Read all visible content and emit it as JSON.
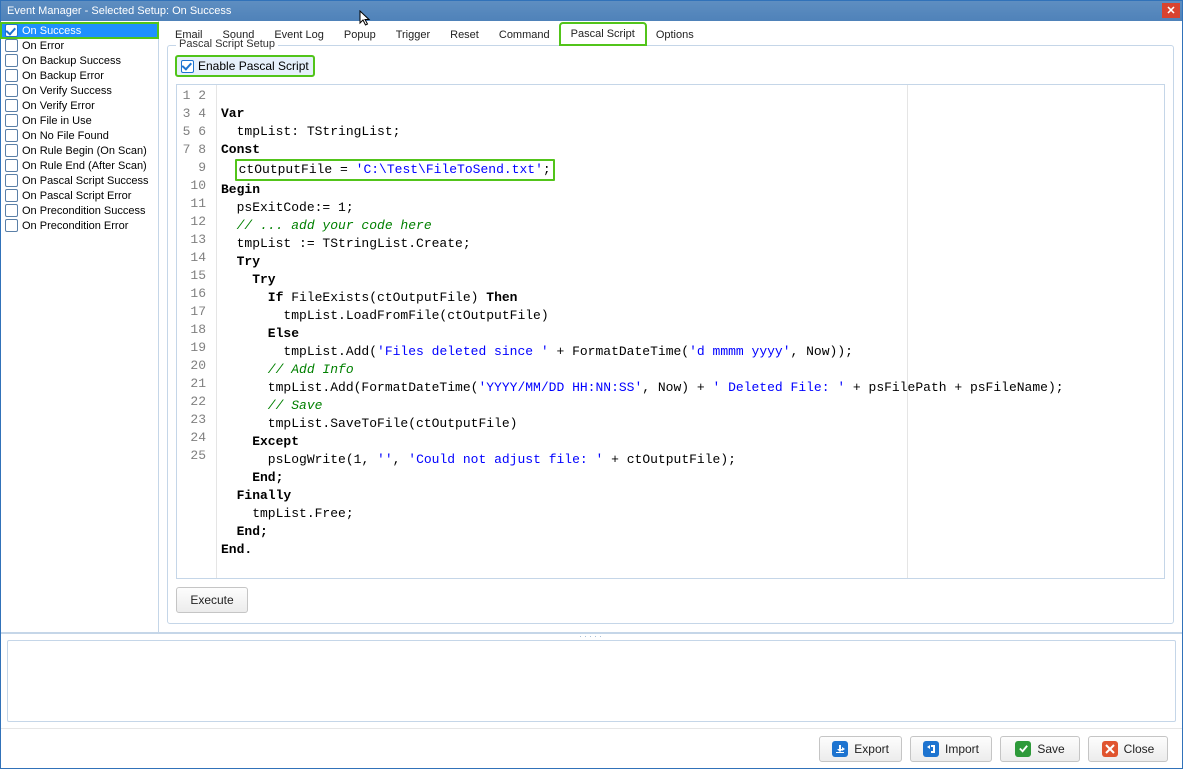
{
  "title": "Event Manager - Selected Setup: On Success",
  "sidebar": {
    "items": [
      {
        "label": "On Success",
        "checked": true,
        "selected": true
      },
      {
        "label": "On Error",
        "checked": false
      },
      {
        "label": "On Backup Success",
        "checked": false
      },
      {
        "label": "On Backup Error",
        "checked": false
      },
      {
        "label": "On Verify Success",
        "checked": false
      },
      {
        "label": "On Verify Error",
        "checked": false
      },
      {
        "label": "On File in Use",
        "checked": false
      },
      {
        "label": "On No File Found",
        "checked": false
      },
      {
        "label": "On Rule Begin (On Scan)",
        "checked": false
      },
      {
        "label": "On Rule End (After Scan)",
        "checked": false
      },
      {
        "label": "On Pascal Script Success",
        "checked": false
      },
      {
        "label": "On Pascal Script Error",
        "checked": false
      },
      {
        "label": "On Precondition Success",
        "checked": false
      },
      {
        "label": "On Precondition Error",
        "checked": false
      }
    ]
  },
  "tabs": [
    {
      "label": "Email"
    },
    {
      "label": "Sound"
    },
    {
      "label": "Event Log"
    },
    {
      "label": "Popup"
    },
    {
      "label": "Trigger"
    },
    {
      "label": "Reset"
    },
    {
      "label": "Command"
    },
    {
      "label": "Pascal Script",
      "active": true
    },
    {
      "label": "Options"
    }
  ],
  "panel": {
    "title": "Pascal Script Setup",
    "enable_label": "Enable Pascal Script",
    "enable_checked": true,
    "execute_label": "Execute"
  },
  "code": {
    "line_count": 25,
    "l1": "Var",
    "l2_pre": "  tmpList: TStringList;",
    "l3": "Const",
    "l4_pre": "  ",
    "l4_hl_a": "ctOutputFile = ",
    "l4_hl_s": "'C:\\Test\\FileToSend.txt'",
    "l4_hl_z": ";",
    "l5": "Begin",
    "l6_a": "  psExitCode:= ",
    "l6_n": "1",
    "l6_z": ";",
    "l7": "  // ... add your code here",
    "l8": "  tmpList := TStringList.Create;",
    "l9": "  Try",
    "l10": "    Try",
    "l11_a": "      If",
    "l11_b": " FileExists(ctOutputFile) ",
    "l11_c": "Then",
    "l12": "        tmpList.LoadFromFile(ctOutputFile)",
    "l13": "      Else",
    "l14_a": "        tmpList.Add(",
    "l14_s1": "'Files deleted since '",
    "l14_b": " + FormatDateTime(",
    "l14_s2": "'d mmmm yyyy'",
    "l14_c": ", Now));",
    "l15": "      // Add Info",
    "l16_a": "      tmpList.Add(FormatDateTime(",
    "l16_s1": "'YYYY/MM/DD HH:NN:SS'",
    "l16_b": ", Now) + ",
    "l16_s2": "' Deleted File: '",
    "l16_c": " + psFilePath + psFileName);",
    "l17": "      // Save",
    "l18": "      tmpList.SaveToFile(ctOutputFile)",
    "l19": "    Except",
    "l20_a": "      psLogWrite(",
    "l20_n": "1",
    "l20_b": ", ",
    "l20_s1": "''",
    "l20_c": ", ",
    "l20_s2": "'Could not adjust file: '",
    "l20_d": " + ctOutputFile);",
    "l21": "    End;",
    "l22": "  Finally",
    "l23": "    tmpList.Free;",
    "l24": "  End;",
    "l25": "End."
  },
  "footer": {
    "export": "Export",
    "import": "Import",
    "save": "Save",
    "close": "Close"
  },
  "colors": {
    "accent_blue": "#1e74d0",
    "highlight_green": "#52c41a",
    "string_blue": "#0000ff",
    "comment_green": "#008000",
    "titlebar": "#5a8bbf",
    "close_red": "#d9432f"
  }
}
